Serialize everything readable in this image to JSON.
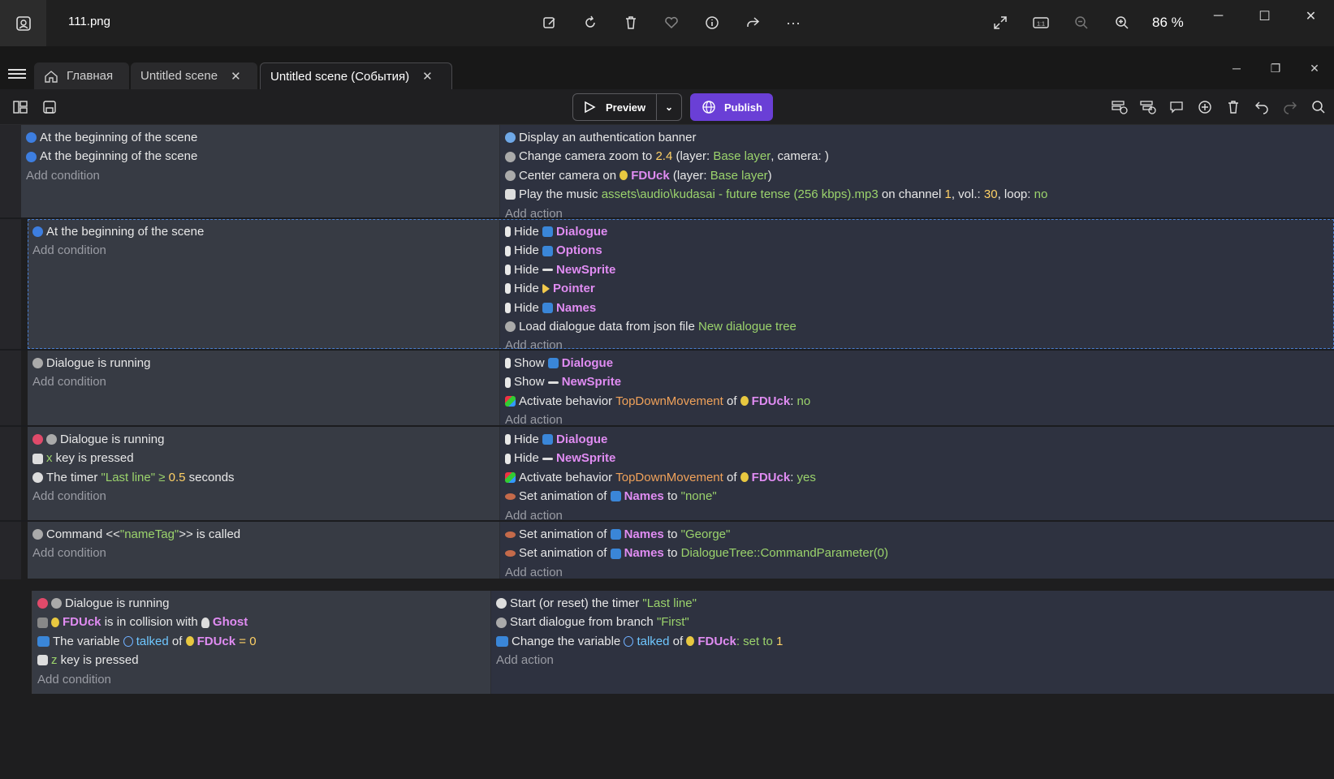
{
  "viewer": {
    "filename": "111.png",
    "zoom": "86 %",
    "tools": [
      "edit-icon",
      "rotate-icon",
      "delete-icon",
      "favorite-icon",
      "info-icon",
      "share-icon",
      "more-icon"
    ],
    "more_label": "···"
  },
  "tabs": {
    "home": "Главная",
    "scene": "Untitled scene",
    "events": "Untitled scene (События)"
  },
  "toolbar": {
    "preview_label": "Preview",
    "publish_label": "Publish"
  },
  "events": [
    {
      "conditions": [
        "At the beginning of the scene",
        "At the beginning of the scene"
      ],
      "add_condition": "Add condition",
      "actions": {
        "a1": "Display an authentication banner",
        "a2_pre": "Change camera zoom to",
        "a2_num": "2.4",
        "a2_mid": "(layer:",
        "a2_layer": "Base layer",
        "a2_post": ", camera: )",
        "a3_pre": "Center camera on",
        "a3_obj": "FDUck",
        "a3_mid": "(layer:",
        "a3_layer": "Base layer",
        "a3_post": ")",
        "a4_pre": "Play the music",
        "a4_file": "assets\\audio\\kudasai - future tense (256 kbps).mp3",
        "a4_mid": "on channel",
        "a4_ch": "1",
        "a4_vol_l": ", vol.:",
        "a4_vol": "30",
        "a4_loop_l": ", loop:",
        "a4_loop": "no"
      },
      "add_action": "Add action"
    },
    {
      "conditions": [
        "At the beginning of the scene"
      ],
      "add_condition": "Add condition",
      "hide_label": "Hide",
      "hide_objects": [
        "Dialogue",
        "Options",
        "NewSprite",
        "Pointer",
        "Names"
      ],
      "load_pre": "Load dialogue data from json file",
      "load_file": "New dialogue tree",
      "add_action": "Add action"
    },
    {
      "conditions": [
        "Dialogue is running"
      ],
      "add_condition": "Add condition",
      "show_label": "Show",
      "show_objects": [
        "Dialogue",
        "NewSprite"
      ],
      "beh_pre": "Activate behavior",
      "beh_name": "TopDownMovement",
      "beh_of": "of",
      "beh_obj": "FDUck",
      "beh_val": "no",
      "add_action": "Add action"
    },
    {
      "c1": "Dialogue is running",
      "c2_key": "x",
      "c2_post": "key is pressed",
      "c3_pre": "The timer",
      "c3_name": "\"Last line\"",
      "c3_op": "≥",
      "c3_num": "0.5",
      "c3_post": "seconds",
      "add_condition": "Add condition",
      "hide_label": "Hide",
      "hide_objects": [
        "Dialogue",
        "NewSprite"
      ],
      "beh_pre": "Activate behavior",
      "beh_name": "TopDownMovement",
      "beh_of": "of",
      "beh_obj": "FDUck",
      "beh_val": "yes",
      "anim_pre": "Set animation of",
      "anim_obj": "Names",
      "anim_to": "to",
      "anim_val": "\"none\"",
      "add_action": "Add action"
    },
    {
      "c1_pre": "Command <<",
      "c1_str": "\"nameTag\"",
      "c1_post": ">> is called",
      "add_condition": "Add condition",
      "anim_pre": "Set animation of",
      "anim_obj": "Names",
      "anim_to": "to",
      "anim_val1": "\"George\"",
      "anim_val2": "DialogueTree::CommandParameter(0)",
      "add_action": "Add action"
    },
    {
      "c1": "Dialogue is running",
      "c2_obj": "FDUck",
      "c2_mid": "is in collision with",
      "c2_obj2": "Ghost",
      "c3_pre": "The variable",
      "c3_var": "talked",
      "c3_of": "of",
      "c3_obj": "FDUck",
      "c3_op": "= 0",
      "c4_key": "z",
      "c4_post": "key is pressed",
      "add_condition": "Add condition",
      "a1_pre": "Start (or reset) the timer",
      "a1_str": "\"Last line\"",
      "a2_pre": "Start dialogue from branch",
      "a2_str": "\"First\"",
      "a3_pre": "Change the variable",
      "a3_var": "talked",
      "a3_of": "of",
      "a3_obj": "FDUck",
      "a3_set": ": set to",
      "a3_num": "1",
      "add_action": "Add action"
    }
  ]
}
